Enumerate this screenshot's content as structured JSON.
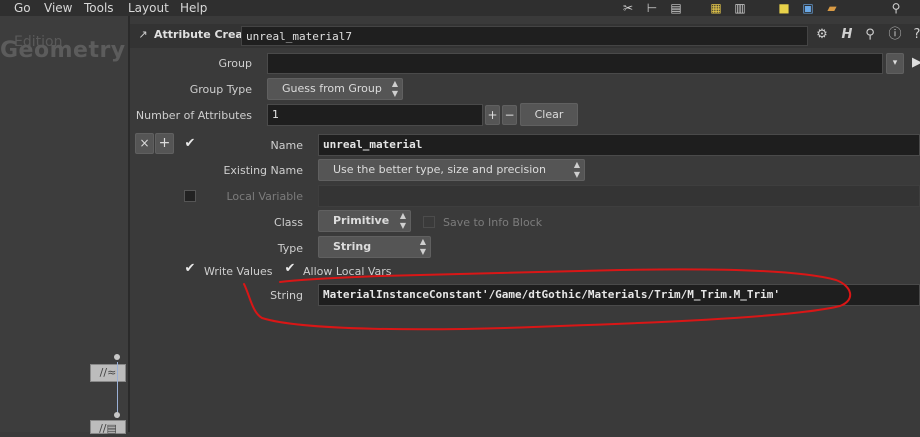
{
  "menubar": {
    "items": [
      "Go",
      "View",
      "Tools",
      "Layout",
      "Help"
    ]
  },
  "toolbar_icons": [
    "tools-icon",
    "tree-icon",
    "list-icon",
    "palette-icon",
    "grid-icon",
    "note-icon",
    "image-add-icon",
    "box-icon",
    "search-icon"
  ],
  "left_pane": {
    "ghost_top": "Edition",
    "ghost_title": "Geometry"
  },
  "node_header": {
    "type_label": "Attribute Create",
    "node_name": "unreal_material7"
  },
  "params": {
    "group_label": "Group",
    "group_value": "",
    "group_type_label": "Group Type",
    "group_type_value": "Guess from Group",
    "num_attrs_label": "Number of Attributes",
    "num_attrs_value": "1",
    "clear_label": "Clear",
    "name_label": "Name",
    "name_value": "unreal_material",
    "existing_name_label": "Existing Name",
    "existing_name_value": "Use the better type, size and precision",
    "local_variable_label": "Local Variable",
    "class_label": "Class",
    "class_value": "Primitive",
    "save_info_label": "Save to Info Block",
    "type_label": "Type",
    "type_value": "String",
    "write_values_label": "Write Values",
    "allow_local_vars_label": "Allow Local Vars",
    "string_label": "String",
    "string_value": "MaterialInstanceConstant'/Game/dtGothic/Materials/Trim/M_Trim.M_Trim'"
  },
  "colors": {
    "annotation": "#d91616",
    "field_bg": "#1e1e1e",
    "panel_bg": "#3a3a3a"
  }
}
